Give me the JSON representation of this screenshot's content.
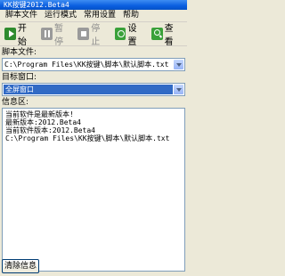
{
  "window": {
    "title": "KK按键2012.Beta4"
  },
  "menu": [
    "脚本文件",
    "运行模式",
    "常用设置",
    "帮助"
  ],
  "toolbar": {
    "start_label": "开始",
    "pause_label": "暂停",
    "stop_label": "停止",
    "settings_label": "设置",
    "view_label": "查看"
  },
  "script_file": {
    "label": "脚本文件:",
    "value": "C:\\Program Files\\KK按键\\脚本\\默认脚本.txt"
  },
  "target_window": {
    "label": "目标窗口:",
    "value": "全屏窗口"
  },
  "info": {
    "label": "信息区:",
    "lines": [
      "当前软件是最新版本!",
      "最新版本:2012.Beta4",
      "当前软件版本:2012.Beta4",
      "C:\\Program Files\\KK按键\\脚本\\默认脚本.txt"
    ]
  },
  "clear_label": "清除信息"
}
